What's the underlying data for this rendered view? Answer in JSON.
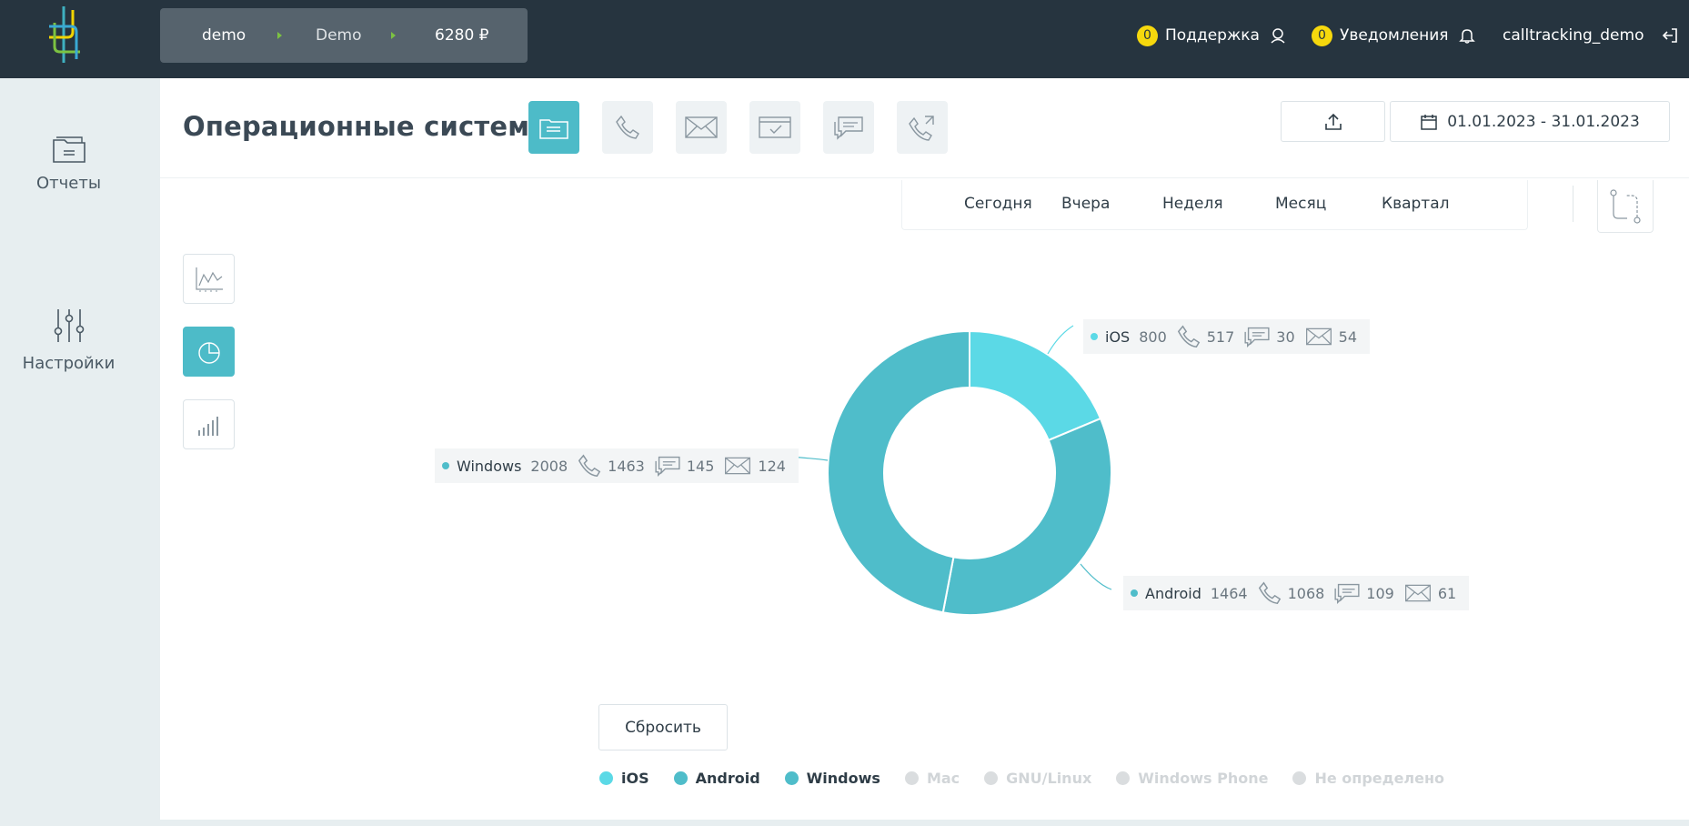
{
  "topbar": {
    "breadcrumbs": [
      "demo",
      "Demo",
      "6280 ₽"
    ],
    "support": {
      "count": "0",
      "label": "Поддержка"
    },
    "notifications": {
      "count": "0",
      "label": "Уведомления"
    },
    "user": "calltracking_demo"
  },
  "sidebar": {
    "items": [
      {
        "label": "Отчеты",
        "icon": "reports-folder-icon"
      },
      {
        "label": "Настройки",
        "icon": "settings-sliders-icon"
      }
    ]
  },
  "header": {
    "title": "Операционные системы",
    "date_range": "01.01.2023 - 31.01.2023"
  },
  "periods": [
    "Сегодня",
    "Вчера",
    "Неделя",
    "Месяц",
    "Квартал"
  ],
  "reset_label": "Сбросить",
  "colors": {
    "accent": "#4dbbc8",
    "ios": "#5bd9e6",
    "android": "#4fbdca",
    "windows": "#4fbdca",
    "badge": "#f6d80d",
    "topbar": "#26343f"
  },
  "chart_data": {
    "type": "pie",
    "variant": "donut",
    "series": [
      {
        "name": "iOS",
        "value": 800,
        "calls": 517,
        "chats": 30,
        "emails": 54
      },
      {
        "name": "Android",
        "value": 1464,
        "calls": 1068,
        "chats": 109,
        "emails": 61
      },
      {
        "name": "Windows",
        "value": 2008,
        "calls": 1463,
        "chats": 145,
        "emails": 124
      }
    ],
    "legend": [
      {
        "name": "iOS",
        "enabled": true
      },
      {
        "name": "Android",
        "enabled": true
      },
      {
        "name": "Windows",
        "enabled": true
      },
      {
        "name": "Mac",
        "enabled": false
      },
      {
        "name": "GNU/Linux",
        "enabled": false
      },
      {
        "name": "Windows Phone",
        "enabled": false
      },
      {
        "name": "Не определено",
        "enabled": false
      }
    ],
    "legend_position": "bottom"
  }
}
